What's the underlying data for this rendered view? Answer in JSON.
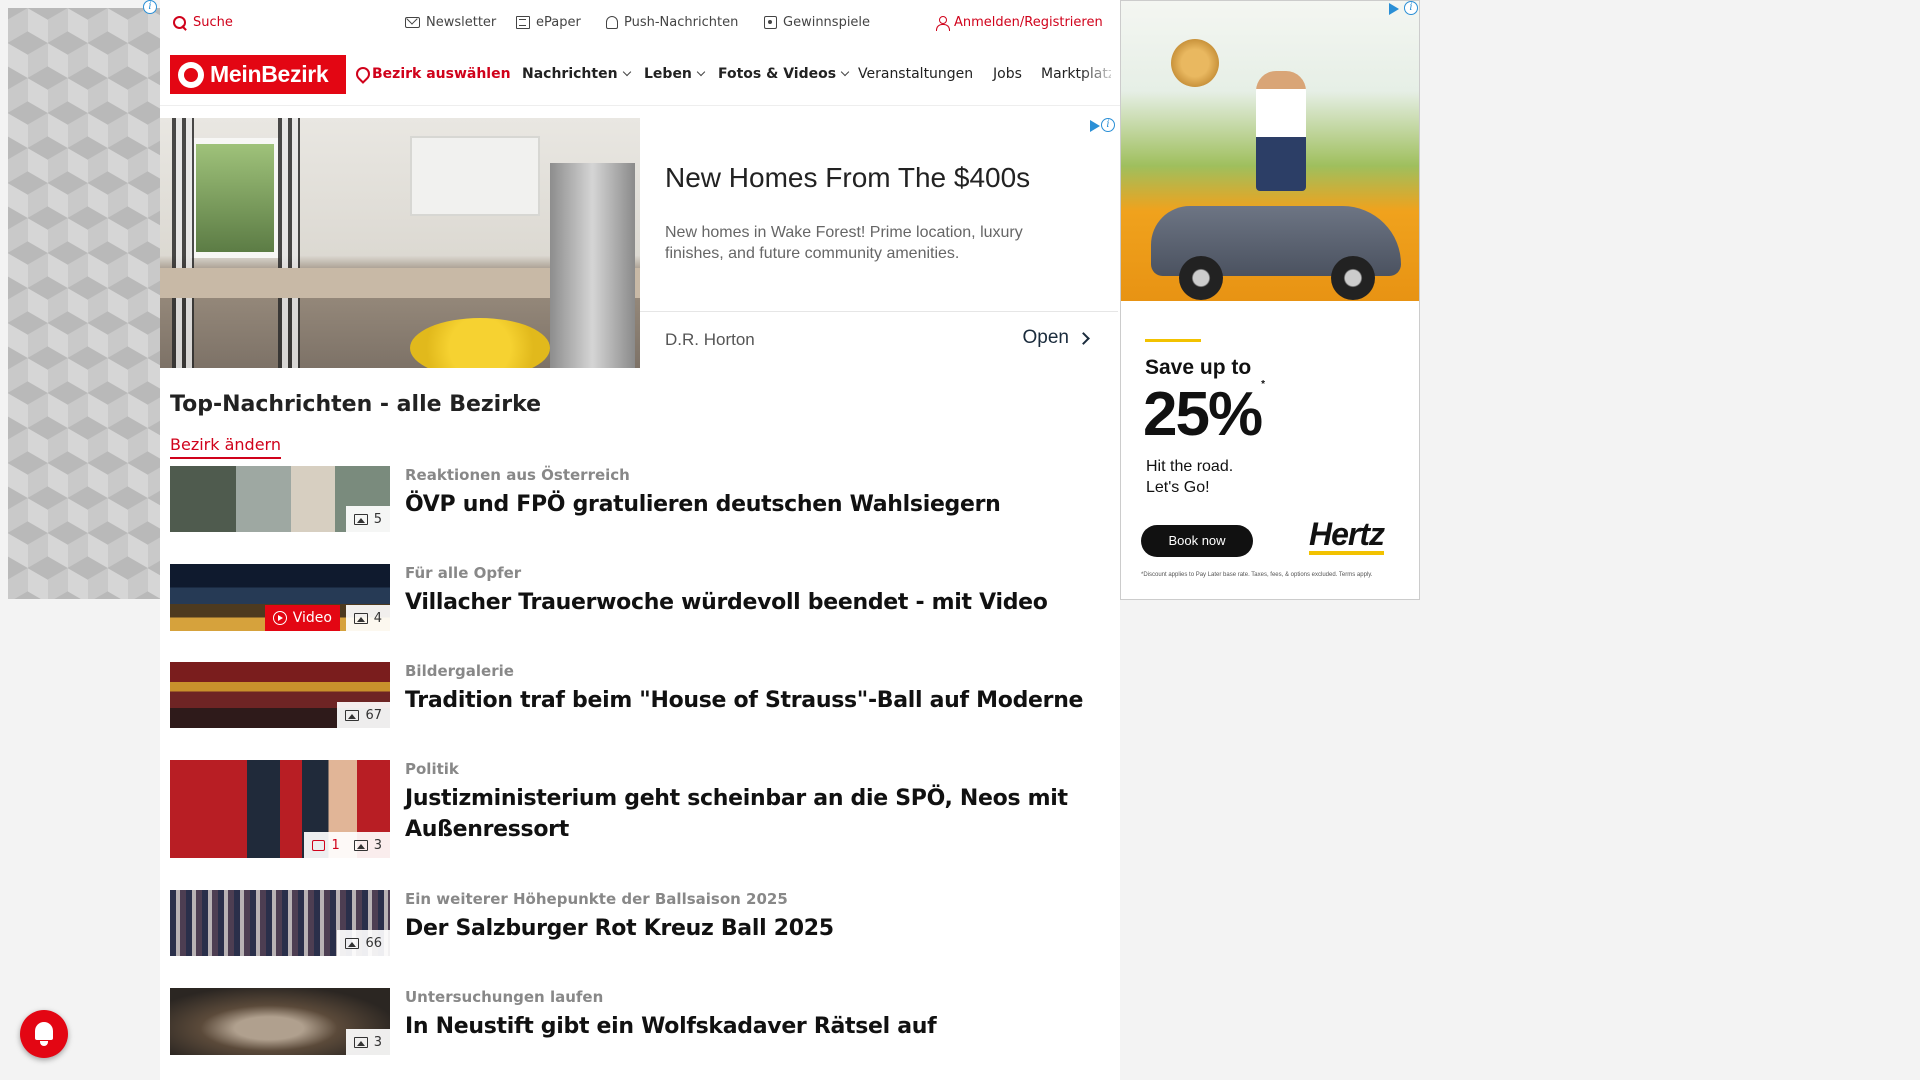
{
  "topbar": {
    "search": "Suche",
    "newsletter": "Newsletter",
    "epaper": "ePaper",
    "push": "Push-Nachrichten",
    "games": "Gewinnspiele",
    "login": "Anmelden/Registrieren"
  },
  "brand": {
    "logo_text": "MeinBezirk",
    "color": "#e30613"
  },
  "nav": {
    "district": "Bezirk auswählen",
    "items": [
      "Nachrichten",
      "Leben",
      "Fotos & Videos",
      "Veranstaltungen",
      "Jobs",
      "Marktplatz"
    ]
  },
  "native_ad": {
    "title": "New Homes From The $400s",
    "description": "New homes in Wake Forest! Prime location, luxury finishes, and future community amenities.",
    "advertiser": "D.R. Horton",
    "cta": "Open"
  },
  "section": {
    "title": "Top-Nachrichten - alle Bezirke",
    "change_link": "Bezirk ändern"
  },
  "articles": [
    {
      "kicker": "Reaktionen aus Österreich",
      "headline": "ÖVP und FPÖ gratulieren deutschen Wahlsiegern",
      "images": "5"
    },
    {
      "kicker": "Für alle Opfer",
      "headline": "Villacher Trauerwoche würdevoll beendet - mit Video",
      "images": "4",
      "video": "Video"
    },
    {
      "kicker": "Bildergalerie",
      "headline": "Tradition traf beim \"House of Strauss\"-Ball auf Moderne",
      "images": "67"
    },
    {
      "kicker": "Politik",
      "headline": "Justizministerium geht scheinbar an die SPÖ, Neos mit Außenressort",
      "images": "3",
      "comments": "1"
    },
    {
      "kicker": "Ein weiterer Höhepunkte der Ballsaison 2025",
      "headline": "Der Salzburger Rot Kreuz Ball 2025",
      "images": "66"
    },
    {
      "kicker": "Untersuchungen laufen",
      "headline": "In Neustift gibt ein Wolfskadaver Rätsel auf",
      "images": "3"
    }
  ],
  "right_ad": {
    "save": "Save up to",
    "percent": "25%",
    "percent_mark": "*",
    "tagline_1": "Hit the road.",
    "tagline_2": "Let's Go!",
    "button": "Book now",
    "brand": "Hertz",
    "fine_print": "*Discount applies to Pay Later base rate. Taxes, fees, & options excluded. Terms apply.",
    "accent": "#f2c200"
  },
  "ad_choices": "i"
}
